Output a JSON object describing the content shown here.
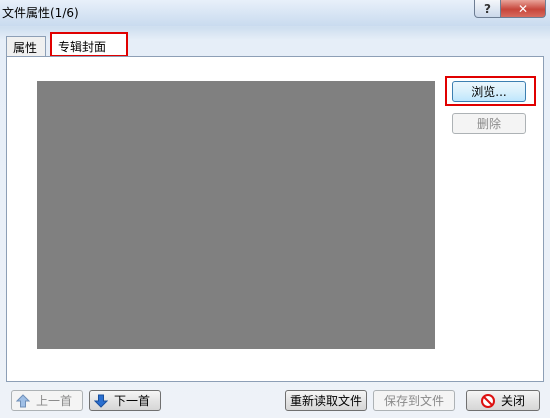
{
  "window": {
    "title": "文件属性(1/6)",
    "help_label": "?",
    "close_label": "✕"
  },
  "tabs": [
    {
      "label": "属性",
      "active": false
    },
    {
      "label": "专辑封面",
      "active": true
    }
  ],
  "cover": {
    "browse_label": "浏览...",
    "delete_label": "删除"
  },
  "footer": {
    "prev_label": "上一首",
    "next_label": "下一首",
    "reload_label": "重新读取文件",
    "save_label": "保存到文件",
    "close_label": "关闭"
  },
  "colors": {
    "highlight": "#e00000",
    "image_placeholder": "#808080",
    "arrow": "#2a6fd0"
  },
  "icons": {
    "prev": "arrow-up-icon",
    "next": "arrow-down-icon",
    "close": "no-entry-icon"
  }
}
